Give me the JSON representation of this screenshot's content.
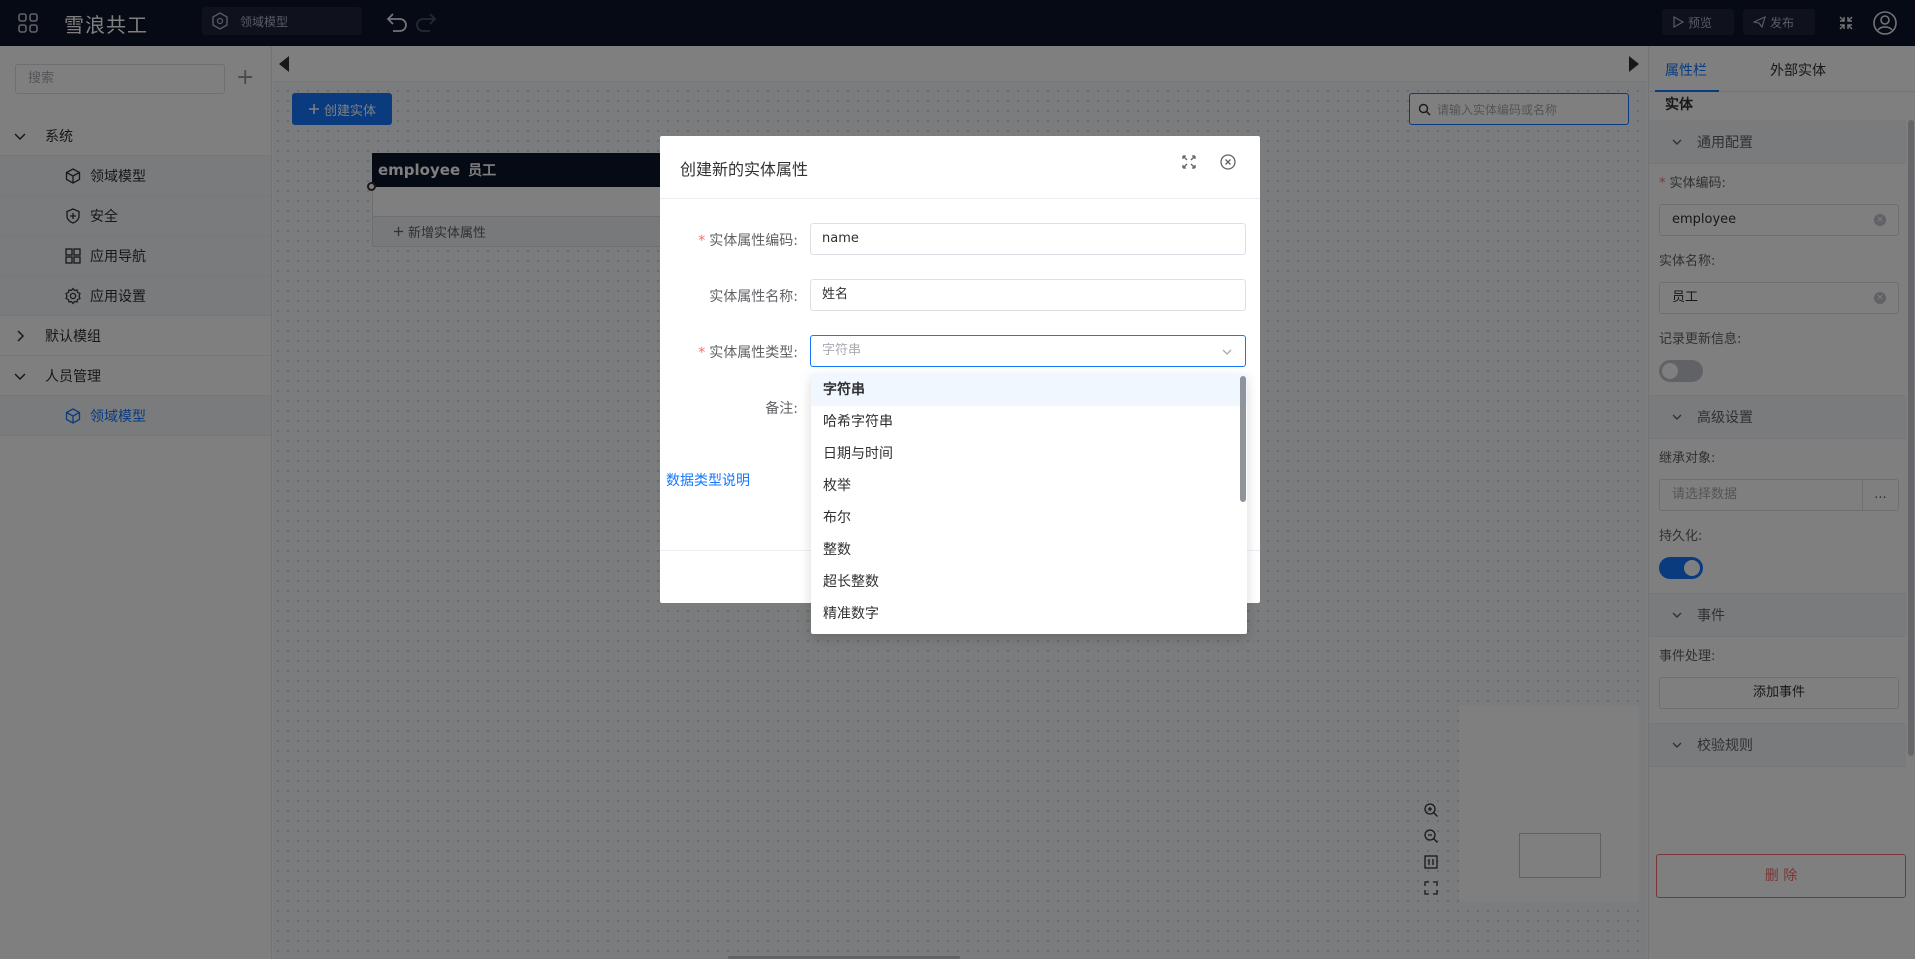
{
  "header": {
    "app_title": "雪浪共工",
    "model_selector": "领域模型",
    "preview_label": "预览",
    "publish_label": "发布"
  },
  "sidebar": {
    "search_placeholder": "搜索",
    "add_symbol": "+",
    "groups": [
      {
        "label": "系统",
        "expanded": true,
        "children": [
          {
            "label": "领域模型",
            "icon": "cube-icon"
          },
          {
            "label": "安全",
            "icon": "shield-plus-icon"
          },
          {
            "label": "应用导航",
            "icon": "grid-icon"
          },
          {
            "label": "应用设置",
            "icon": "gear-icon"
          }
        ]
      },
      {
        "label": "默认模组",
        "expanded": false,
        "children": []
      },
      {
        "label": "人员管理",
        "expanded": true,
        "children": [
          {
            "label": "领域模型",
            "icon": "cube-icon",
            "active": true
          }
        ]
      }
    ]
  },
  "canvas": {
    "create_entity_label": "创建实体",
    "search_placeholder": "请输入实体编码或名称",
    "entity": {
      "code": "employee",
      "name": "员工",
      "add_attribute_label": "新增实体属性"
    }
  },
  "right_panel": {
    "tabs": [
      "属性栏",
      "外部实体"
    ],
    "active_tab": "属性栏",
    "entity_title": "实体",
    "sections": {
      "general": "通用配置",
      "advanced": "高级设置",
      "events": "事件",
      "validation": "校验规则"
    },
    "fields": {
      "entity_code_label": "实体编码:",
      "entity_code_value": "employee",
      "entity_name_label": "实体名称:",
      "entity_name_value": "员工",
      "record_update_label": "记录更新信息:",
      "record_update_on": false,
      "inherit_label": "继承对象:",
      "inherit_placeholder": "请选择数据",
      "inherit_more": "...",
      "persist_label": "持久化:",
      "persist_on": true,
      "event_handling_label": "事件处理:",
      "add_event_label": "添加事件"
    },
    "delete_label": "删 除"
  },
  "dialog": {
    "title": "创建新的实体属性",
    "fields": {
      "code_label": "实体属性编码:",
      "code_value": "name",
      "name_label": "实体属性名称:",
      "name_value": "姓名",
      "type_label": "实体属性类型:",
      "type_placeholder": "字符串",
      "remark_label": "备注:"
    },
    "data_type_link": "数据类型说明"
  },
  "dropdown": {
    "options": [
      "字符串",
      "哈希字符串",
      "日期与时间",
      "枚举",
      "布尔",
      "整数",
      "超长整数",
      "精准数字"
    ],
    "selected": "字符串"
  },
  "colors": {
    "accent": "#1677ff",
    "topbar": "#0d1428",
    "danger": "#f56c6c"
  }
}
